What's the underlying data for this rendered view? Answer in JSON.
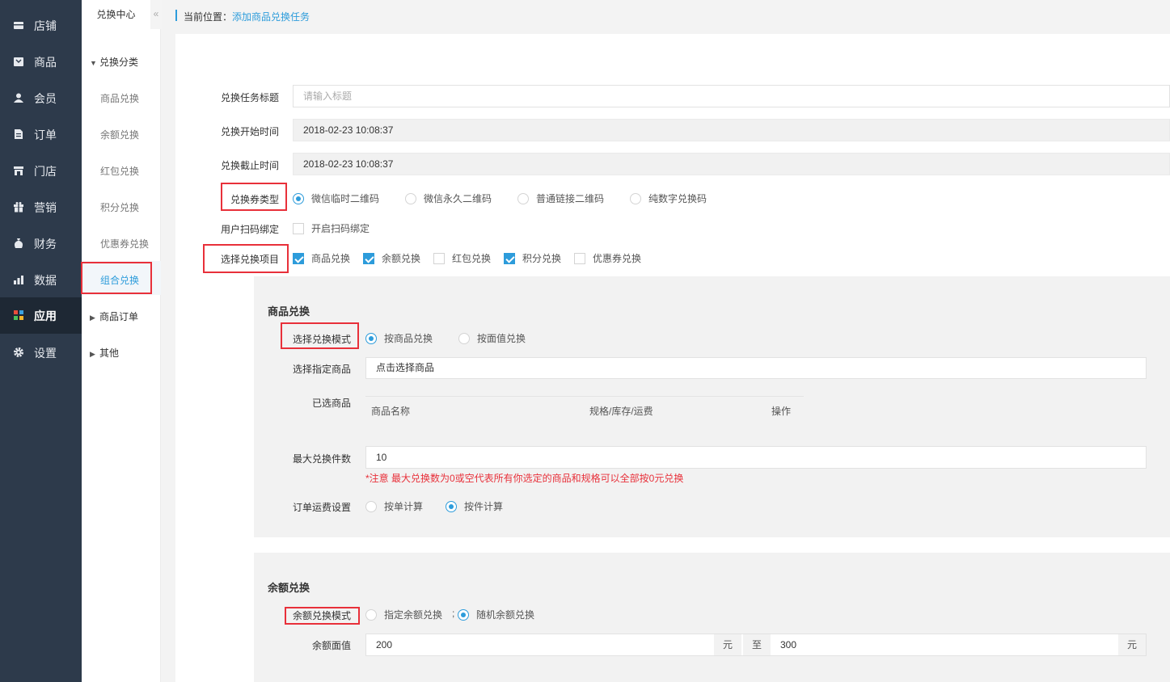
{
  "nav": {
    "items": [
      {
        "label": "店铺",
        "icon": "store-icon"
      },
      {
        "label": "商品",
        "icon": "goods-icon"
      },
      {
        "label": "会员",
        "icon": "member-icon"
      },
      {
        "label": "订单",
        "icon": "order-icon"
      },
      {
        "label": "门店",
        "icon": "shop-icon"
      },
      {
        "label": "营销",
        "icon": "gift-icon"
      },
      {
        "label": "财务",
        "icon": "money-bag-icon"
      },
      {
        "label": "数据",
        "icon": "bar-chart-icon"
      },
      {
        "label": "应用",
        "icon": "apps-grid-icon"
      },
      {
        "label": "设置",
        "icon": "gear-icon"
      }
    ],
    "active": "应用"
  },
  "subnav": {
    "title": "兑换中心",
    "collapse_icon": "«",
    "group1": "兑换分类",
    "items": [
      "商品兑换",
      "余额兑换",
      "红包兑换",
      "积分兑换",
      "优惠券兑换",
      "组合兑换"
    ],
    "active": "组合兑换",
    "group2": "商品订单",
    "group3": "其他"
  },
  "breadcrumb": {
    "prefix": "当前位置：",
    "current": "添加商品兑换任务"
  },
  "form": {
    "title_label": "兑换任务标题",
    "title_placeholder": "请输入标题",
    "start_label": "兑换开始时间",
    "start_value": "2018-02-23 10:08:37",
    "end_label": "兑换截止时间",
    "end_value": "2018-02-23 10:08:37",
    "type_label": "兑换券类型",
    "type_options": [
      "微信临时二维码",
      "微信永久二维码",
      "普通链接二维码",
      "纯数字兑换码"
    ],
    "type_selected": 0,
    "bind_label": "用户扫码绑定",
    "bind_option": "开启扫码绑定",
    "items_label": "选择兑换项目",
    "items_options": [
      "商品兑换",
      "余额兑换",
      "红包兑换",
      "积分兑换",
      "优惠券兑换"
    ],
    "items_checked": [
      true,
      true,
      false,
      true,
      false
    ]
  },
  "goods_section": {
    "title": "商品兑换",
    "mode_label": "选择兑换模式",
    "mode_options": [
      "按商品兑换",
      "按面值兑换"
    ],
    "mode_selected": 0,
    "pick_label": "选择指定商品",
    "pick_value": "点击选择商品",
    "selected_label": "已选商品",
    "table_headers": [
      "商品名称",
      "规格/库存/运费",
      "操作"
    ],
    "max_label": "最大兑换件数",
    "max_value": "10",
    "note": "*注意 最大兑换数为0或空代表所有你选定的商品和规格可以全部按0元兑换",
    "freight_label": "订单运费设置",
    "freight_options": [
      "按单计算",
      "按件计算"
    ],
    "freight_selected": 1
  },
  "balance_section": {
    "title": "余额兑换",
    "mode_label": "余额兑换模式",
    "mode_options": [
      "指定余额兑换",
      "随机余额兑换"
    ],
    "mode_selected": 1,
    "separator": ";",
    "value_label": "余额面值",
    "min_value": "200",
    "unit": "元",
    "to": "至",
    "max_value": "300"
  },
  "colors": {
    "accent": "#2d9cdb",
    "sidebar": "#2d3a4b",
    "highlight": "#e8303a"
  }
}
